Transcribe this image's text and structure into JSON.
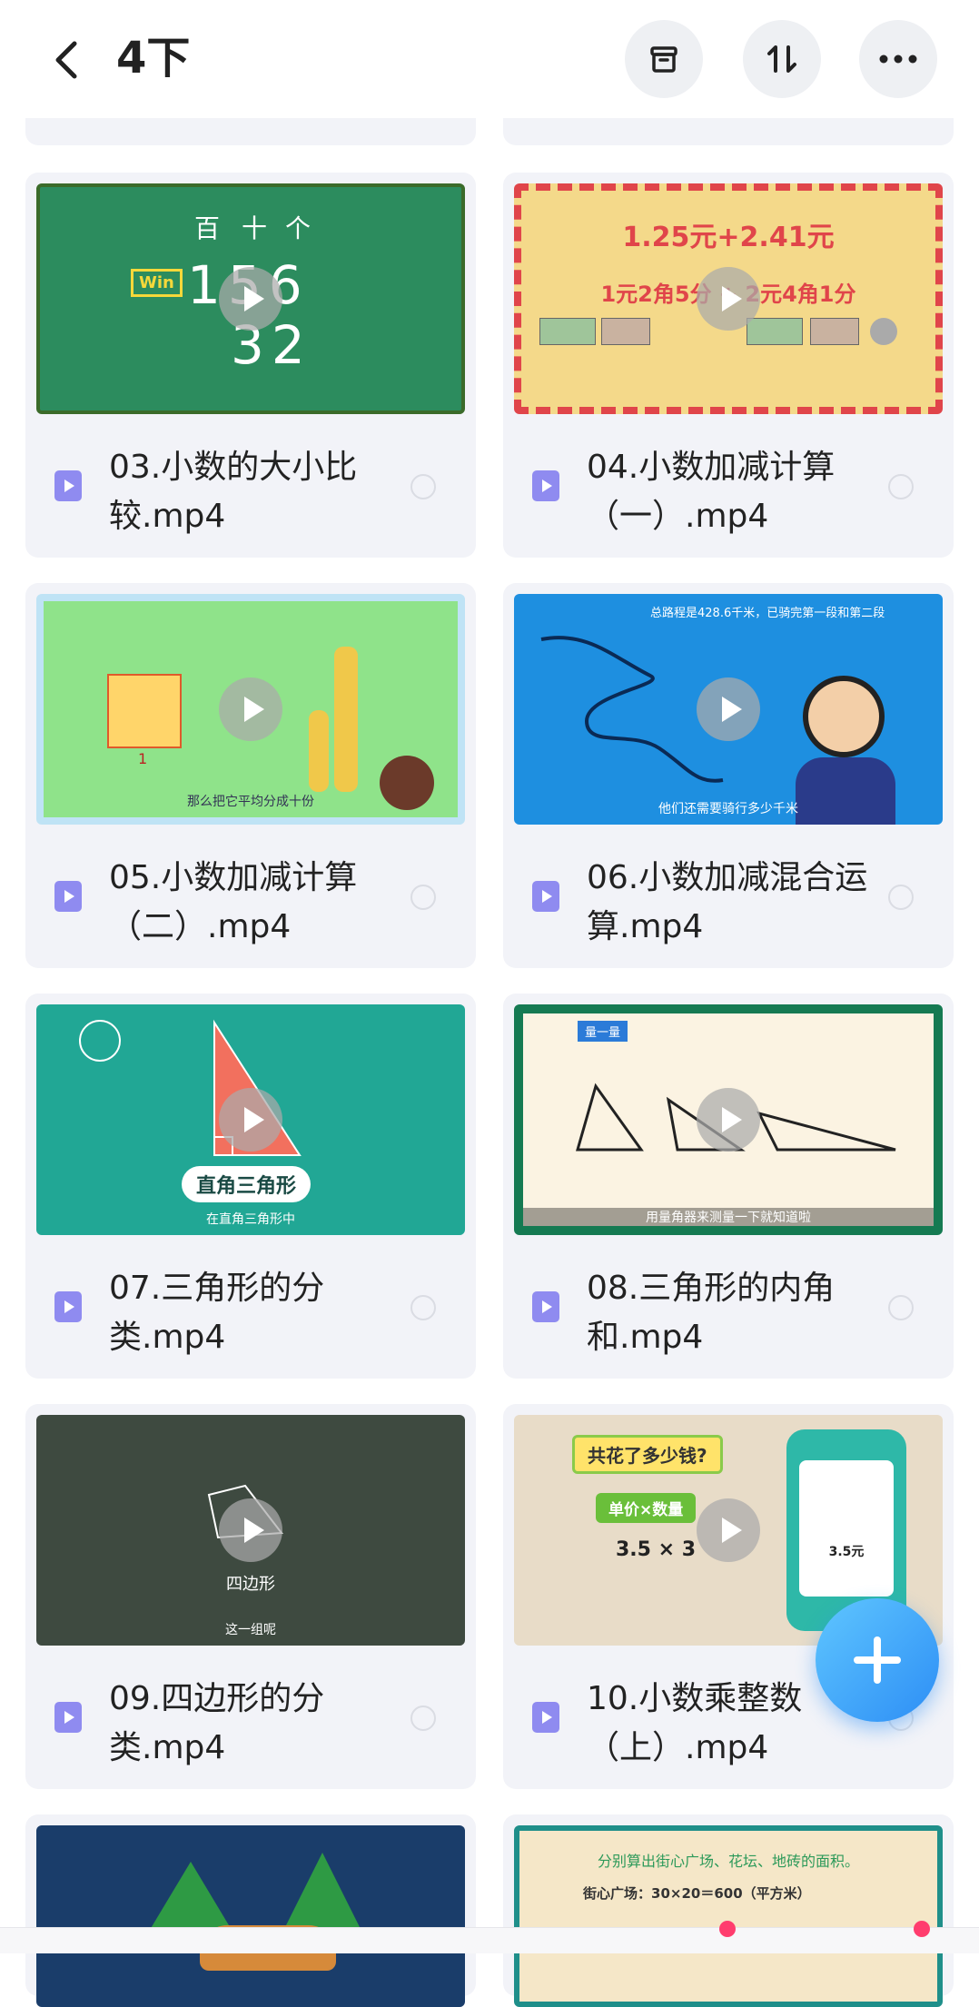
{
  "header": {
    "title": "4下",
    "icons": [
      "back-icon",
      "archive-icon",
      "sort-icon",
      "more-icon"
    ]
  },
  "files": [
    {
      "name": "03.小数的大小比较.mp4",
      "thumb_text": [
        "百",
        "十",
        "个",
        "156",
        "32",
        "Win"
      ]
    },
    {
      "name": "04.小数加减计算（一）.mp4",
      "thumb_text": [
        "1.25元+2.41元",
        "1元2角5分 + 2元4角1分"
      ]
    },
    {
      "name": "05.小数加减计算（二）.mp4",
      "thumb_text": [
        "1",
        "那么把它平均分成十份"
      ]
    },
    {
      "name": "06.小数加减混合运算.mp4",
      "thumb_text": [
        "总路程是428.6千米，已骑完第一段和第二段",
        "他们还需要骑行多少千米"
      ]
    },
    {
      "name": "07.三角形的分类.mp4",
      "thumb_text": [
        "直角三角形",
        "在直角三角形中"
      ]
    },
    {
      "name": "08.三角形的内角和.mp4",
      "thumb_text": [
        "量一量",
        "用量角器来测量一下就知道啦"
      ]
    },
    {
      "name": "09.四边形的分类.mp4",
      "thumb_text": [
        "四边形",
        "这一组呢"
      ]
    },
    {
      "name": "10.小数乘整数（上）.mp4",
      "thumb_text": [
        "共花了多少钱?",
        "单价×数量",
        "3.5 × 3",
        "3.5元"
      ]
    },
    {
      "name": "",
      "thumb_text": []
    },
    {
      "name": "",
      "thumb_text": [
        "分别算出街心广场、花坛、地砖的面积。",
        "街心广场：30×20＝600（平方米）"
      ]
    }
  ],
  "colors": {
    "accent": "#8f8bf0",
    "card_bg": "#f2f3f8",
    "fab": "#2d8ef5"
  }
}
